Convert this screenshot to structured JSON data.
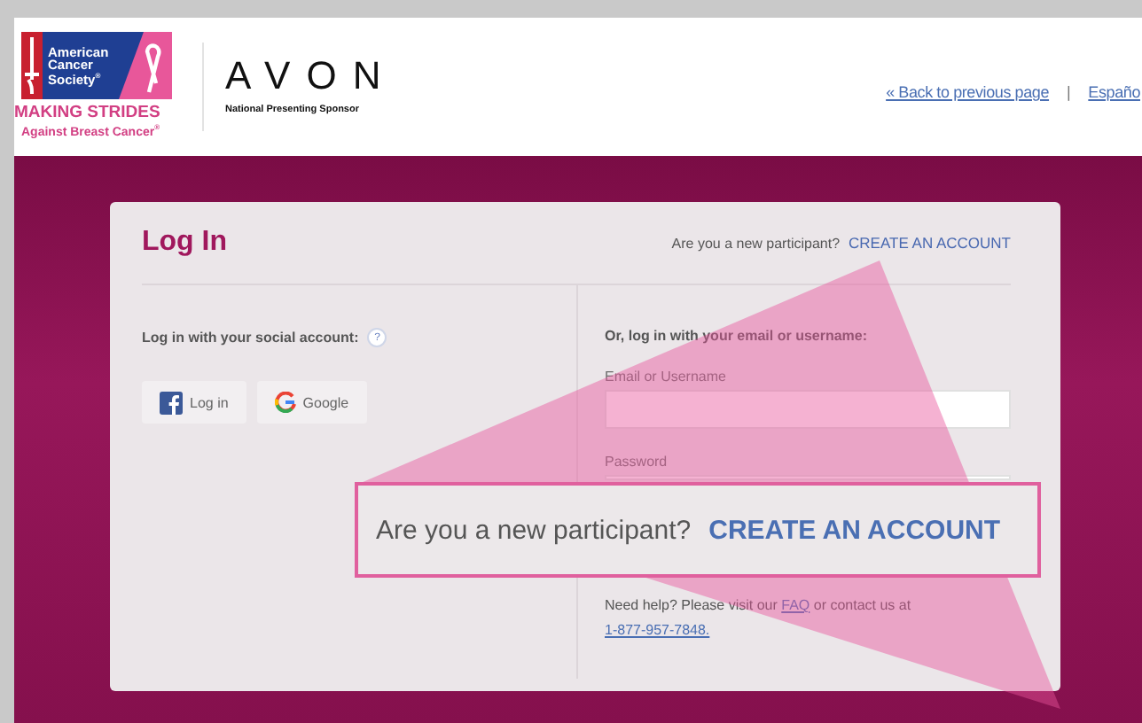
{
  "header": {
    "logo": {
      "org": "American Cancer Society",
      "org_mark": "®",
      "event": "MAKING STRIDES",
      "tagline": "Against Breast Cancer",
      "tagline_mark": "®"
    },
    "sponsor": {
      "name": "AVON",
      "role": "National Presenting Sponsor"
    },
    "links": [
      {
        "label": "« Back to previous page"
      },
      {
        "label": "Españo"
      }
    ],
    "separator": "|"
  },
  "login": {
    "title": "Log In",
    "prompt": "Are you a new participant?",
    "create_link": "CREATE AN ACCOUNT",
    "social": {
      "label": "Log in with your social account:",
      "help": "?",
      "buttons": [
        {
          "kind": "facebook",
          "label": "Log in"
        },
        {
          "kind": "google",
          "label": "Google"
        }
      ]
    },
    "form": {
      "heading": "Or, log in with your email or username:",
      "fields": [
        {
          "label": "Email or Username"
        },
        {
          "label": "Password"
        }
      ],
      "help": {
        "before": "Need help? Please visit our",
        "link": "FAQ",
        "after": "or contact us at",
        "phone": "1-877-957-7848."
      }
    }
  },
  "callout": {
    "prompt": "Are you a new participant?",
    "link": "CREATE AN ACCOUNT"
  }
}
